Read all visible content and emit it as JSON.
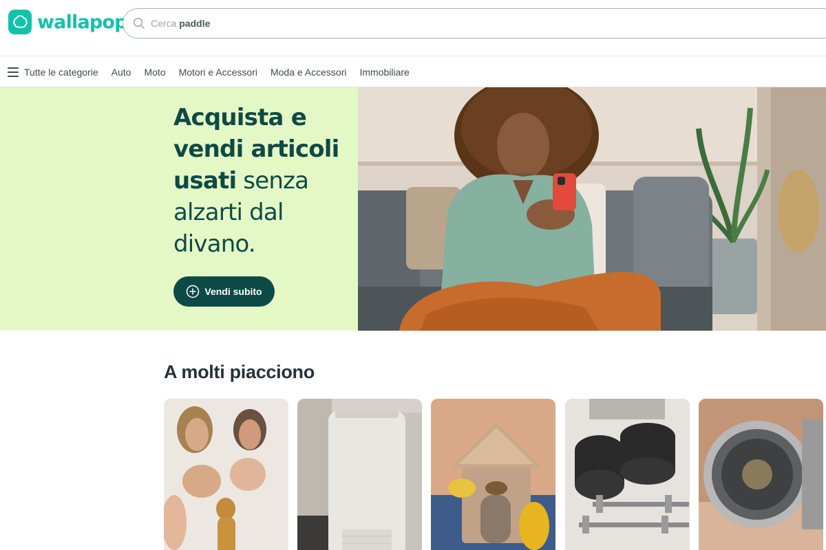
{
  "brand": {
    "name": "wallapop",
    "color": "#13c1ac"
  },
  "search": {
    "prefix": "Cerca",
    "term": "paddle"
  },
  "nav": {
    "all_label": "Tutte le categorie",
    "categories": [
      "Auto",
      "Moto",
      "Motori e Accessori",
      "Moda e Accessori",
      "Immobiliare"
    ]
  },
  "hero": {
    "line1": "Acquista e",
    "line2": "vendi articoli",
    "line3_bold": "usati",
    "line3_rest": " senza",
    "line4": "alzarti dal",
    "line5": "divano.",
    "cta_label": "Vendi subito",
    "bg_color": "#e4f8c6",
    "text_color": "#0e4a45"
  },
  "section": {
    "title": "A molti piacciono",
    "items": [
      {
        "image": "religious-statues"
      },
      {
        "image": "portable-air-conditioner"
      },
      {
        "image": "ceramic-house"
      },
      {
        "image": "dumbbell-weights"
      },
      {
        "image": "wristwatch"
      }
    ]
  }
}
